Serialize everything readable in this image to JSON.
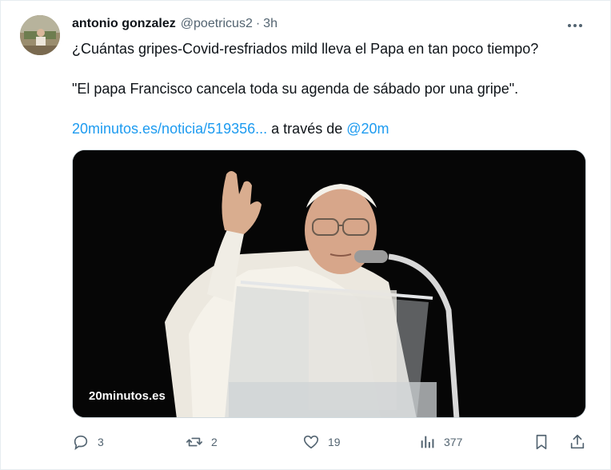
{
  "tweet": {
    "author_name": "antonio gonzalez",
    "handle": "@poetricus2",
    "separator": "·",
    "time": "3h",
    "line1": "¿Cuántas gripes-Covid-resfriados mild lleva el Papa en tan poco tiempo?",
    "line2": "\"El papa Francisco cancela toda su agenda de sábado por una gripe\".",
    "link_text": "20minutos.es/noticia/519356...",
    "via_text": " a través de ",
    "mention": "@20m"
  },
  "media": {
    "watermark": "20minutos.es"
  },
  "actions": {
    "replies": "3",
    "retweets": "2",
    "likes": "19",
    "views": "377"
  },
  "icons": {
    "more": "more-horizontal-icon",
    "reply": "reply-icon",
    "retweet": "retweet-icon",
    "like": "heart-icon",
    "views": "views-icon",
    "bookmark": "bookmark-icon",
    "share": "share-icon"
  },
  "colors": {
    "link": "#1d9bf0",
    "muted": "#536471",
    "text": "#0f1419"
  }
}
